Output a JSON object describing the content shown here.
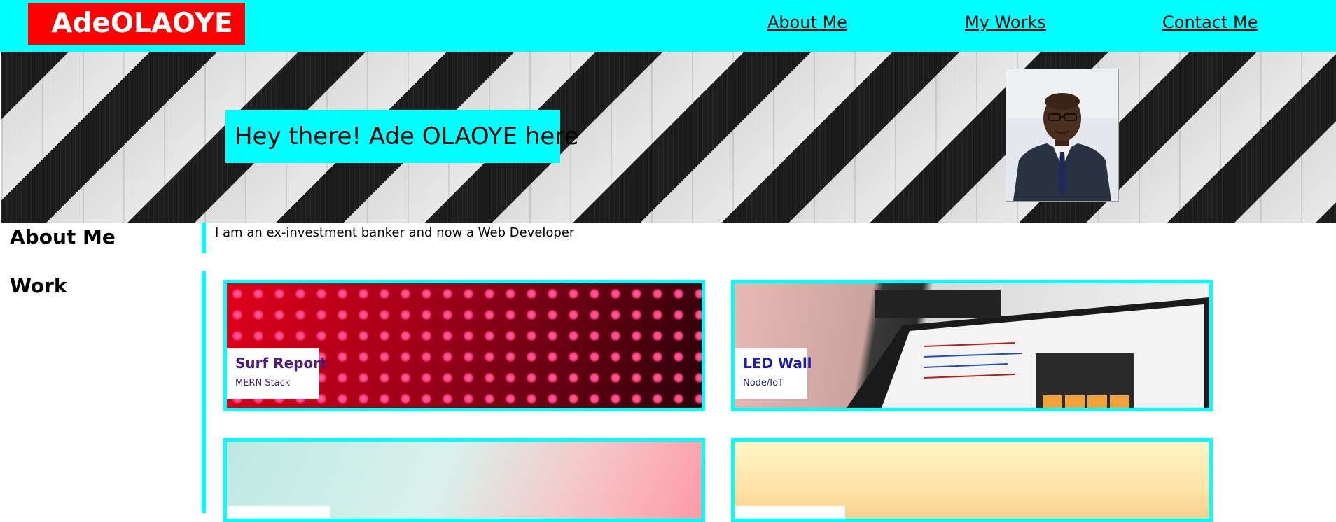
{
  "header": {
    "logo": "AdeOLAOYE",
    "nav": [
      {
        "label": "About Me"
      },
      {
        "label": "My Works"
      },
      {
        "label": "Contact Me"
      }
    ],
    "background_color": "#00ffff",
    "logo_color": "#ff0000"
  },
  "hero": {
    "title": "Hey there! Ade OLAOYE here"
  },
  "about": {
    "heading": "About Me",
    "text": "I am an ex-investment banker and now a Web Developer"
  },
  "work": {
    "heading": "Work",
    "cards": [
      {
        "title": "Surf Report",
        "subtitle": "MERN Stack",
        "color": "#4b1a7a"
      },
      {
        "title": "LED Wall",
        "subtitle": "Node/IoT",
        "color": "#1b1bb0"
      }
    ]
  }
}
